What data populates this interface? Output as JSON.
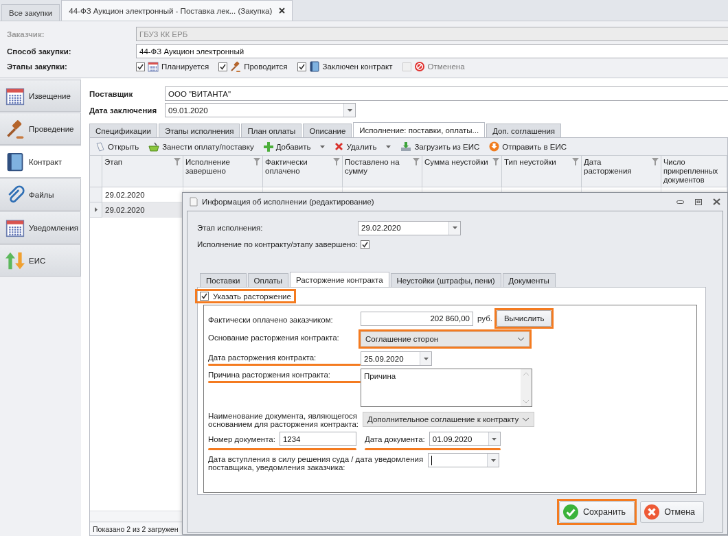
{
  "tabs": [
    {
      "label": "Все закупки",
      "selected": false,
      "closable": false
    },
    {
      "label": "44-ФЗ Аукцион электронный - Поставка лек... (Закупка)",
      "selected": true,
      "closable": true
    }
  ],
  "header": {
    "fields": [
      {
        "label": "Заказчик:",
        "value": "ГБУЗ КК ЕРБ",
        "disabled": true
      },
      {
        "label": "Способ закупки:",
        "value": "44-ФЗ Аукцион электронный",
        "disabled": false
      }
    ],
    "stages_label": "Этапы закупки:",
    "stages": [
      {
        "label": "Планируется",
        "kind": "calendar",
        "checked": true,
        "disabled": false
      },
      {
        "label": "Проводится",
        "kind": "gavel",
        "checked": true,
        "disabled": false
      },
      {
        "label": "Заключен контракт",
        "kind": "book",
        "checked": true,
        "disabled": false
      },
      {
        "label": "Отменена",
        "kind": "cancel",
        "checked": false,
        "disabled": true
      }
    ]
  },
  "sidebar": {
    "items": [
      {
        "label": "Извещение",
        "kind": "calendar",
        "selected": false
      },
      {
        "label": "Проведение",
        "kind": "gavel",
        "selected": false
      },
      {
        "label": "Контракт",
        "kind": "book",
        "selected": true
      },
      {
        "label": "Файлы",
        "kind": "clip",
        "selected": false
      },
      {
        "label": "Уведомления",
        "kind": "calendar",
        "selected": false
      },
      {
        "label": "ЕИС",
        "kind": "arrows",
        "selected": false
      }
    ]
  },
  "contract": {
    "supplier_label": "Поставщик",
    "supplier": "ООО \"ВИТАНТА\"",
    "date_label": "Дата заключения",
    "date": "09.01.2020",
    "tabs": [
      {
        "label": "Спецификации",
        "selected": false
      },
      {
        "label": "Этапы исполнения",
        "selected": false
      },
      {
        "label": "План оплаты",
        "selected": false
      },
      {
        "label": "Описание",
        "selected": false
      },
      {
        "label": "Исполнение: поставки, оплаты...",
        "selected": true
      },
      {
        "label": "Доп. соглашения",
        "selected": false
      }
    ],
    "toolbar": [
      {
        "label": "Открыть",
        "kind": "open",
        "dropdown": false
      },
      {
        "label": "Занести оплату/поставку",
        "kind": "basket",
        "dropdown": false
      },
      {
        "label": "Добавить",
        "kind": "add",
        "dropdown": true
      },
      {
        "label": "Удалить",
        "kind": "delete",
        "dropdown": true
      },
      {
        "label": "Загрузить из ЕИС",
        "kind": "download",
        "dropdown": false
      },
      {
        "label": "Отправить в ЕИС",
        "kind": "send",
        "dropdown": false
      }
    ],
    "table": {
      "columns": [
        "Этап",
        "Исполнение завершено",
        "Фактически оплачено",
        "Поставлено на сумму",
        "Сумма неустойки",
        "Тип неустойки",
        "Дата расторжения",
        "Число прикрепленных документов"
      ],
      "rows": [
        {
          "cells": [
            "29.02.2020"
          ],
          "selected": false
        },
        {
          "cells": [
            "29.02.2020"
          ],
          "selected": true
        }
      ]
    },
    "status": "Показано 2 из 2 загружен"
  },
  "dialog": {
    "title": "Информация об исполнении (редактирование)",
    "stage_label": "Этап исполнения:",
    "stage": "29.02.2020",
    "completed_label": "Исполнение по контракту/этапу завершено:",
    "completed": true,
    "tabs": [
      {
        "label": "Поставки",
        "selected": false
      },
      {
        "label": "Оплаты",
        "selected": false
      },
      {
        "label": "Расторжение контракта",
        "selected": true
      },
      {
        "label": "Неустойки (штрафы, пени)",
        "selected": false
      },
      {
        "label": "Документы",
        "selected": false
      }
    ],
    "terminate": {
      "label": "Указать расторжение",
      "checked": true,
      "boxed": true
    },
    "fields": [
      {
        "kind": "amount",
        "label": "Фактически оплачено заказчиком:",
        "value": "202 860,00",
        "unit": "руб.",
        "button": "Вычислить",
        "button_boxed": true
      },
      {
        "kind": "select",
        "label": "Основание расторжения контракта:",
        "value": "Соглашение сторон",
        "boxed": true
      },
      {
        "kind": "date",
        "label": "Дата расторжения контракта:",
        "value": "25.09.2020",
        "underlined": true
      },
      {
        "kind": "memo",
        "label": "Причина расторжения контракта:",
        "value": "Причина",
        "underlined": true
      },
      {
        "kind": "select",
        "label": "Наименование документа, являющегося основанием для расторжения контракта:",
        "value": "Дополнительное соглашение к контракту"
      },
      {
        "kind": "pair",
        "items": [
          {
            "kind": "text",
            "label": "Номер документа:",
            "value": "1234",
            "underlined": true
          },
          {
            "kind": "date",
            "label": "Дата документа:",
            "value": "01.09.2020",
            "underlined": true
          }
        ]
      },
      {
        "kind": "date-long",
        "label": "Дата вступления в силу решения суда / дата уведомления поставщика, уведомления заказчика:"
      }
    ],
    "buttons": [
      {
        "label": "Сохранить",
        "kind": "save",
        "boxed": true
      },
      {
        "label": "Отмена",
        "kind": "dismiss",
        "boxed": false
      }
    ]
  }
}
